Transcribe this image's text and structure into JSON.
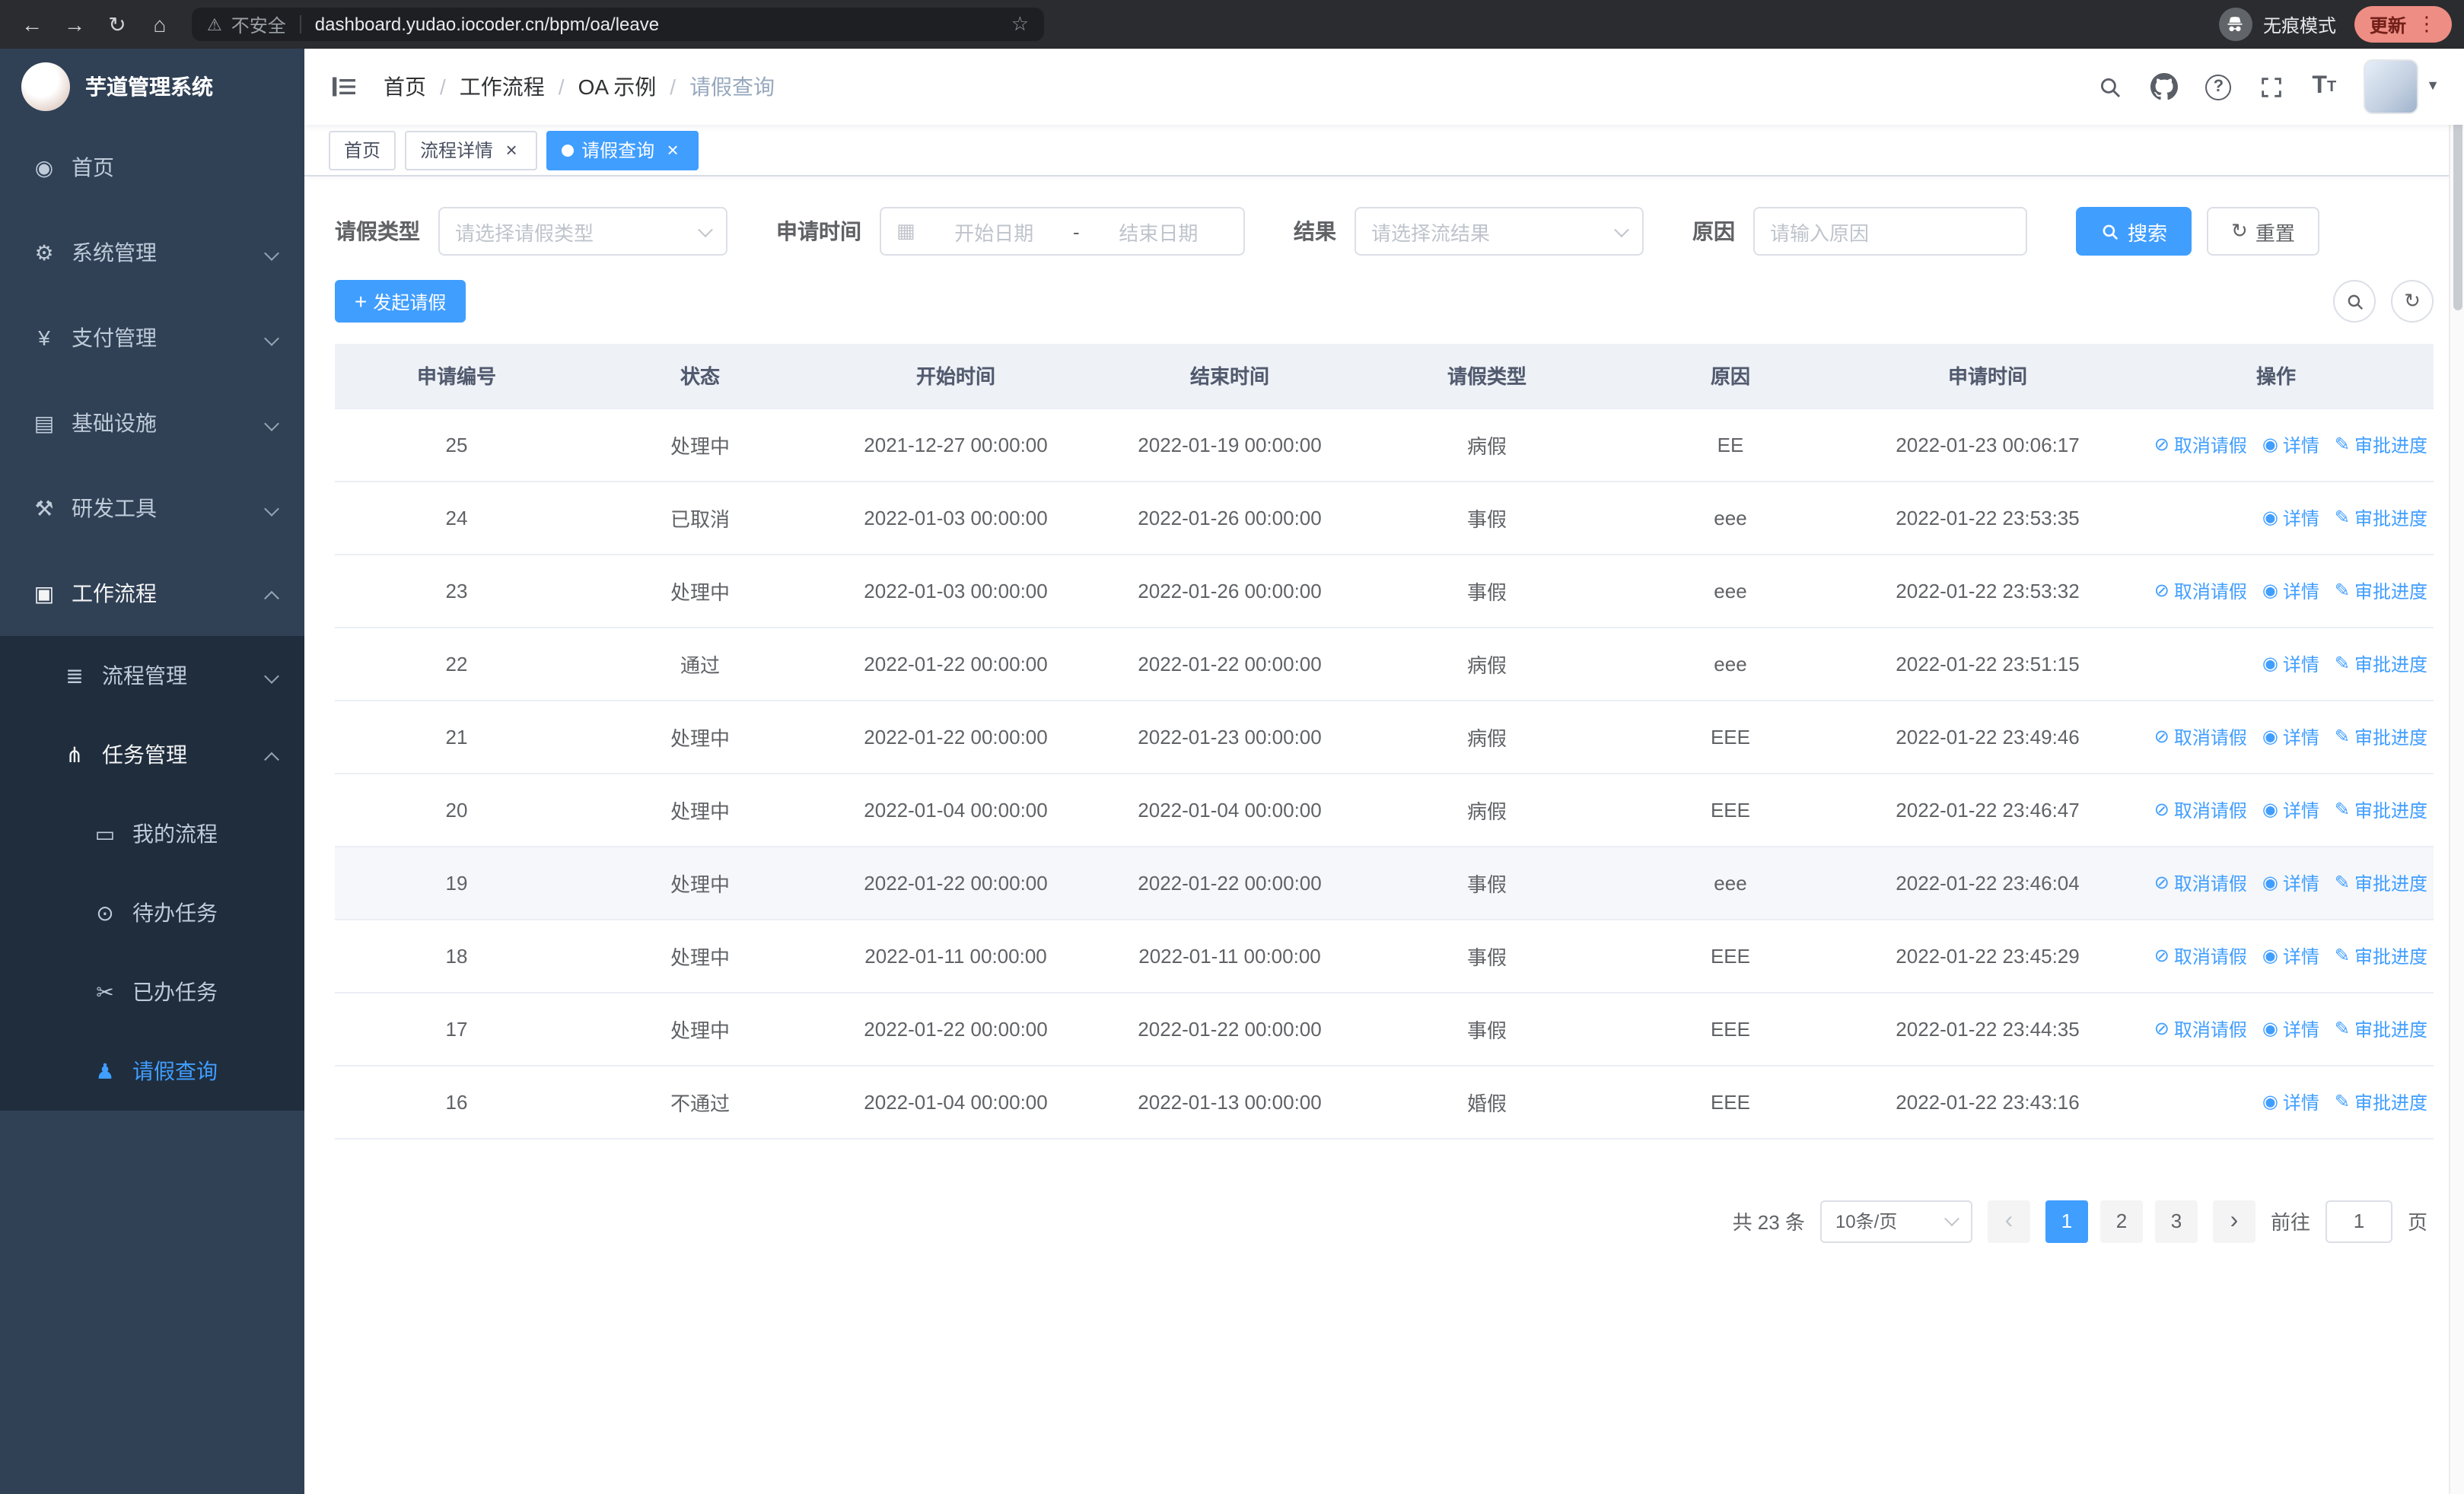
{
  "browser": {
    "security_warning": "不安全",
    "url": "dashboard.yudao.iocoder.cn/bpm/oa/leave",
    "incognito_label": "无痕模式",
    "update_button": "更新"
  },
  "sidebar": {
    "logo_title": "芋道管理系统",
    "menu": [
      {
        "id": "home",
        "label": "首页",
        "icon": "dashboard-icon"
      },
      {
        "id": "system-mgmt",
        "label": "系统管理",
        "icon": "gear-icon",
        "expandable": true,
        "expanded": false
      },
      {
        "id": "payment-mgmt",
        "label": "支付管理",
        "icon": "payment-icon",
        "expandable": true,
        "expanded": false
      },
      {
        "id": "infrastructure",
        "label": "基础设施",
        "icon": "infrastructure-icon",
        "expandable": true,
        "expanded": false
      },
      {
        "id": "devtools",
        "label": "研发工具",
        "icon": "devtools-icon",
        "expandable": true,
        "expanded": false
      },
      {
        "id": "workflow",
        "label": "工作流程",
        "icon": "workflow-icon",
        "expandable": true,
        "expanded": true,
        "children": [
          {
            "id": "process-mgmt",
            "label": "流程管理",
            "icon": "process-mgmt-icon",
            "expandable": true,
            "expanded": false
          },
          {
            "id": "task-mgmt",
            "label": "任务管理",
            "icon": "task-mgmt-icon",
            "expandable": true,
            "expanded": true,
            "children": [
              {
                "id": "my-process",
                "label": "我的流程",
                "icon": "my-process-icon"
              },
              {
                "id": "todo-task",
                "label": "待办任务",
                "icon": "todo-task-icon"
              },
              {
                "id": "done-task",
                "label": "已办任务",
                "icon": "done-task-icon"
              },
              {
                "id": "leave-query",
                "label": "请假查询",
                "icon": "leave-query-icon",
                "active": true
              }
            ]
          }
        ]
      }
    ]
  },
  "header": {
    "breadcrumb": [
      "首页",
      "工作流程",
      "OA 示例",
      "请假查询"
    ]
  },
  "tabs": [
    {
      "label": "首页"
    },
    {
      "label": "流程详情",
      "closable": true
    },
    {
      "label": "请假查询",
      "closable": true,
      "active": true
    }
  ],
  "filters": {
    "leave_type_label": "请假类型",
    "leave_type_placeholder": "请选择请假类型",
    "apply_time_label": "申请时间",
    "start_date_placeholder": "开始日期",
    "date_separator": "-",
    "end_date_placeholder": "结束日期",
    "result_label": "结果",
    "result_placeholder": "请选择流结果",
    "reason_label": "原因",
    "reason_placeholder": "请输入原因",
    "search_button": "搜索",
    "reset_button": "重置"
  },
  "toolbar": {
    "create_button": "发起请假"
  },
  "table": {
    "columns": [
      "申请编号",
      "状态",
      "开始时间",
      "结束时间",
      "请假类型",
      "原因",
      "申请时间",
      "操作"
    ],
    "action_icons": {
      "取消请假": "delete-icon",
      "详情": "view-icon",
      "审批进度": "edit-icon"
    },
    "action_names": {
      "取消请假": "cancel-leave-link",
      "详情": "detail-link",
      "审批进度": "approval-progress-link"
    },
    "rows": [
      {
        "id": "25",
        "status": "处理中",
        "start": "2021-12-27 00:00:00",
        "end": "2022-01-19 00:00:00",
        "type": "病假",
        "reason": "EE",
        "applied": "2022-01-23 00:06:17",
        "actions": [
          "取消请假",
          "详情",
          "审批进度"
        ]
      },
      {
        "id": "24",
        "status": "已取消",
        "start": "2022-01-03 00:00:00",
        "end": "2022-01-26 00:00:00",
        "type": "事假",
        "reason": "eee",
        "applied": "2022-01-22 23:53:35",
        "actions": [
          "详情",
          "审批进度"
        ]
      },
      {
        "id": "23",
        "status": "处理中",
        "start": "2022-01-03 00:00:00",
        "end": "2022-01-26 00:00:00",
        "type": "事假",
        "reason": "eee",
        "applied": "2022-01-22 23:53:32",
        "actions": [
          "取消请假",
          "详情",
          "审批进度"
        ]
      },
      {
        "id": "22",
        "status": "通过",
        "start": "2022-01-22 00:00:00",
        "end": "2022-01-22 00:00:00",
        "type": "病假",
        "reason": "eee",
        "applied": "2022-01-22 23:51:15",
        "actions": [
          "详情",
          "审批进度"
        ]
      },
      {
        "id": "21",
        "status": "处理中",
        "start": "2022-01-22 00:00:00",
        "end": "2022-01-23 00:00:00",
        "type": "病假",
        "reason": "EEE",
        "applied": "2022-01-22 23:49:46",
        "actions": [
          "取消请假",
          "详情",
          "审批进度"
        ]
      },
      {
        "id": "20",
        "status": "处理中",
        "start": "2022-01-04 00:00:00",
        "end": "2022-01-04 00:00:00",
        "type": "病假",
        "reason": "EEE",
        "applied": "2022-01-22 23:46:47",
        "actions": [
          "取消请假",
          "详情",
          "审批进度"
        ]
      },
      {
        "id": "19",
        "status": "处理中",
        "start": "2022-01-22 00:00:00",
        "end": "2022-01-22 00:00:00",
        "type": "事假",
        "reason": "eee",
        "applied": "2022-01-22 23:46:04",
        "actions": [
          "取消请假",
          "详情",
          "审批进度"
        ],
        "hover": true
      },
      {
        "id": "18",
        "status": "处理中",
        "start": "2022-01-11 00:00:00",
        "end": "2022-01-11 00:00:00",
        "type": "事假",
        "reason": "EEE",
        "applied": "2022-01-22 23:45:29",
        "actions": [
          "取消请假",
          "详情",
          "审批进度"
        ]
      },
      {
        "id": "17",
        "status": "处理中",
        "start": "2022-01-22 00:00:00",
        "end": "2022-01-22 00:00:00",
        "type": "事假",
        "reason": "EEE",
        "applied": "2022-01-22 23:44:35",
        "actions": [
          "取消请假",
          "详情",
          "审批进度"
        ]
      },
      {
        "id": "16",
        "status": "不通过",
        "start": "2022-01-04 00:00:00",
        "end": "2022-01-13 00:00:00",
        "type": "婚假",
        "reason": "EEE",
        "applied": "2022-01-22 23:43:16",
        "actions": [
          "详情",
          "审批进度"
        ]
      }
    ]
  },
  "pagination": {
    "total_text": "共 23 条",
    "page_size": "10条/页",
    "pages": [
      "1",
      "2",
      "3"
    ],
    "active_page": "1",
    "goto_label": "前往",
    "goto_value": "1",
    "goto_suffix": "页"
  },
  "colors": {
    "primary": "#409EFF",
    "sidebar_bg": "#304156",
    "submenu_bg": "#1f2d3d"
  }
}
